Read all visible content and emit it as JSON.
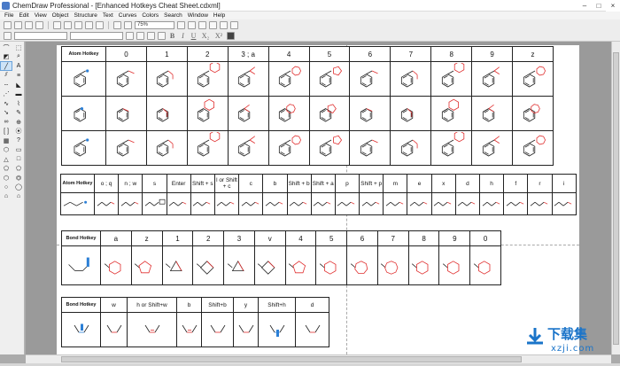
{
  "window": {
    "title": "ChemDraw Professional - [Enhanced Hotkeys Cheat Sheet.cdxml]",
    "controls": [
      "–",
      "□",
      "×"
    ]
  },
  "menu": [
    "File",
    "Edit",
    "View",
    "Object",
    "Structure",
    "Text",
    "Curves",
    "Colors",
    "Search",
    "Window",
    "Help"
  ],
  "toolbar": {
    "zoom": "75%",
    "font_select": "",
    "size_select": "",
    "bold": "B",
    "italic": "I",
    "underline": "U",
    "subscript": "X₂",
    "superscript": "X²"
  },
  "tables": {
    "atom": {
      "header": "Atom Hotkey",
      "keys": [
        "0",
        "1",
        "2",
        "3 ; a",
        "4",
        "5",
        "6",
        "7",
        "8",
        "9",
        "z"
      ]
    },
    "func": {
      "header": "Atom Hotkey",
      "keys": [
        "o ; q",
        "n ; w",
        "s",
        "Enter",
        "Shift + s",
        "l or Shift + c",
        "c",
        "b",
        "Shift + b",
        "Shift + a",
        "p",
        "Shift + p",
        "m",
        "e",
        "x",
        "d",
        "h",
        "f",
        "r",
        "i"
      ]
    },
    "bond": {
      "header": "Bond Hotkey",
      "keys": [
        "a",
        "z",
        "1",
        "2",
        "3",
        "v",
        "4",
        "5",
        "6",
        "7",
        "8",
        "9",
        "0"
      ]
    },
    "bond2": {
      "header": "Bond Hotkey",
      "keys": [
        "w",
        "h or Shift+w",
        "b",
        "Shift+b",
        "y",
        "Shift+h",
        "d"
      ]
    }
  },
  "watermark": {
    "title": "下载集",
    "url": "xzji.com"
  },
  "colors": {
    "accent": "#1a74c9",
    "highlight_red": "#e03030",
    "highlight_blue": "#2b7fd6"
  }
}
